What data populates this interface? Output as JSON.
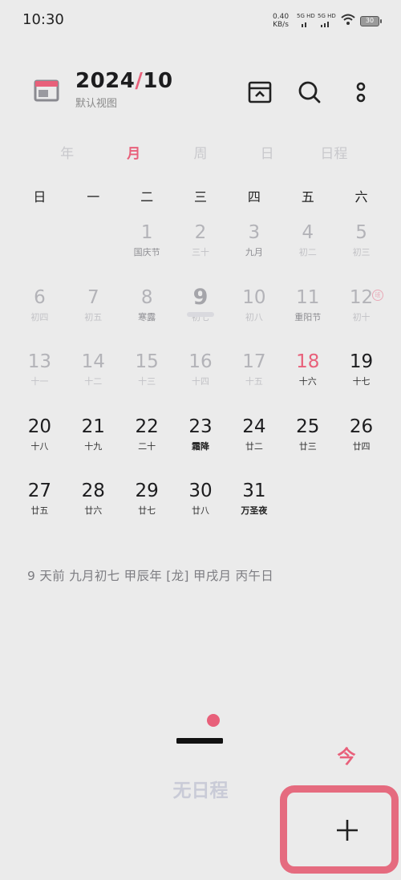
{
  "status": {
    "time": "10:30",
    "net_speed_value": "0.40",
    "net_speed_unit": "KB/s",
    "sim1": "5G HD",
    "sim2": "5G HD",
    "battery": "30"
  },
  "header": {
    "year": "2024",
    "slash": "/",
    "month": "10",
    "subtitle": "默认视图"
  },
  "view_tabs": [
    {
      "label": "年"
    },
    {
      "label": "月"
    },
    {
      "label": "周"
    },
    {
      "label": "日"
    },
    {
      "label": "日程"
    }
  ],
  "weekdays": [
    "日",
    "一",
    "二",
    "三",
    "四",
    "五",
    "六"
  ],
  "days": [
    {
      "num": "",
      "lunar": ""
    },
    {
      "num": "",
      "lunar": ""
    },
    {
      "num": "1",
      "lunar": "国庆节"
    },
    {
      "num": "2",
      "lunar": "三十"
    },
    {
      "num": "3",
      "lunar": "九月"
    },
    {
      "num": "4",
      "lunar": "初二"
    },
    {
      "num": "5",
      "lunar": "初三"
    },
    {
      "num": "6",
      "lunar": "初四"
    },
    {
      "num": "7",
      "lunar": "初五"
    },
    {
      "num": "8",
      "lunar": "寒露"
    },
    {
      "num": "9",
      "lunar": "初七"
    },
    {
      "num": "10",
      "lunar": "初八"
    },
    {
      "num": "11",
      "lunar": "重阳节"
    },
    {
      "num": "12",
      "lunar": "初十",
      "badge": "班"
    },
    {
      "num": "13",
      "lunar": "十一"
    },
    {
      "num": "14",
      "lunar": "十二"
    },
    {
      "num": "15",
      "lunar": "十三"
    },
    {
      "num": "16",
      "lunar": "十四"
    },
    {
      "num": "17",
      "lunar": "十五"
    },
    {
      "num": "18",
      "lunar": "十六"
    },
    {
      "num": "19",
      "lunar": "十七"
    },
    {
      "num": "20",
      "lunar": "十八"
    },
    {
      "num": "21",
      "lunar": "十九"
    },
    {
      "num": "22",
      "lunar": "二十"
    },
    {
      "num": "23",
      "lunar": "霜降"
    },
    {
      "num": "24",
      "lunar": "廿二"
    },
    {
      "num": "25",
      "lunar": "廿三"
    },
    {
      "num": "26",
      "lunar": "廿四"
    },
    {
      "num": "27",
      "lunar": "廿五"
    },
    {
      "num": "28",
      "lunar": "廿六"
    },
    {
      "num": "29",
      "lunar": "廿七"
    },
    {
      "num": "30",
      "lunar": "廿八"
    },
    {
      "num": "31",
      "lunar": "万圣夜"
    }
  ],
  "selected_info": "9 天前   九月初七   甲辰年 [龙] 甲戌月 丙午日",
  "empty_state": "无日程",
  "today_label": "今",
  "colors": {
    "accent": "#e8607a",
    "background": "#ebebeb",
    "highlight_border": "#e56b7f"
  }
}
